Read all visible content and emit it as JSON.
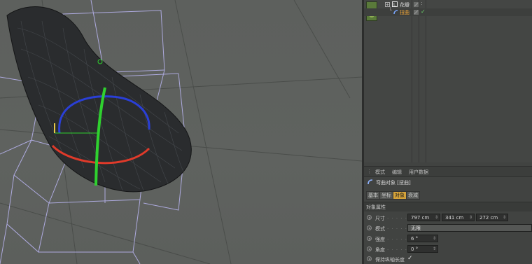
{
  "object_manager": {
    "items": [
      {
        "label": "花瓣",
        "indent": 1
      },
      {
        "label": "扭曲",
        "indent": 2
      }
    ]
  },
  "attribute_manager": {
    "menu": [
      "模式",
      "编辑",
      "用户数据"
    ],
    "object_title": "弯曲对象 [扭曲]",
    "tabs": [
      {
        "label": "基本",
        "active": false
      },
      {
        "label": "坐标",
        "active": false
      },
      {
        "label": "对象",
        "active": true
      },
      {
        "label": "衰减",
        "active": false
      }
    ],
    "section_title": "对象属性",
    "properties": {
      "size": {
        "label": "尺寸",
        "x": "797 cm",
        "y": "341 cm",
        "z": "272 cm"
      },
      "mode": {
        "label": "模式",
        "value": "无限"
      },
      "strength": {
        "label": "强度",
        "value": "6 °"
      },
      "angle": {
        "label": "角度",
        "value": "0 °"
      },
      "keep_length": {
        "label": "保持纵轴长度",
        "checked": true
      }
    }
  },
  "colors": {
    "accent_tab": "#d4a23a",
    "label_orange": "#f0a637",
    "gizmo_green": "#2fd12f",
    "gizmo_blue": "#2a3fd6",
    "gizmo_red": "#e03a2a",
    "wireframe": "#b6b2ec"
  }
}
